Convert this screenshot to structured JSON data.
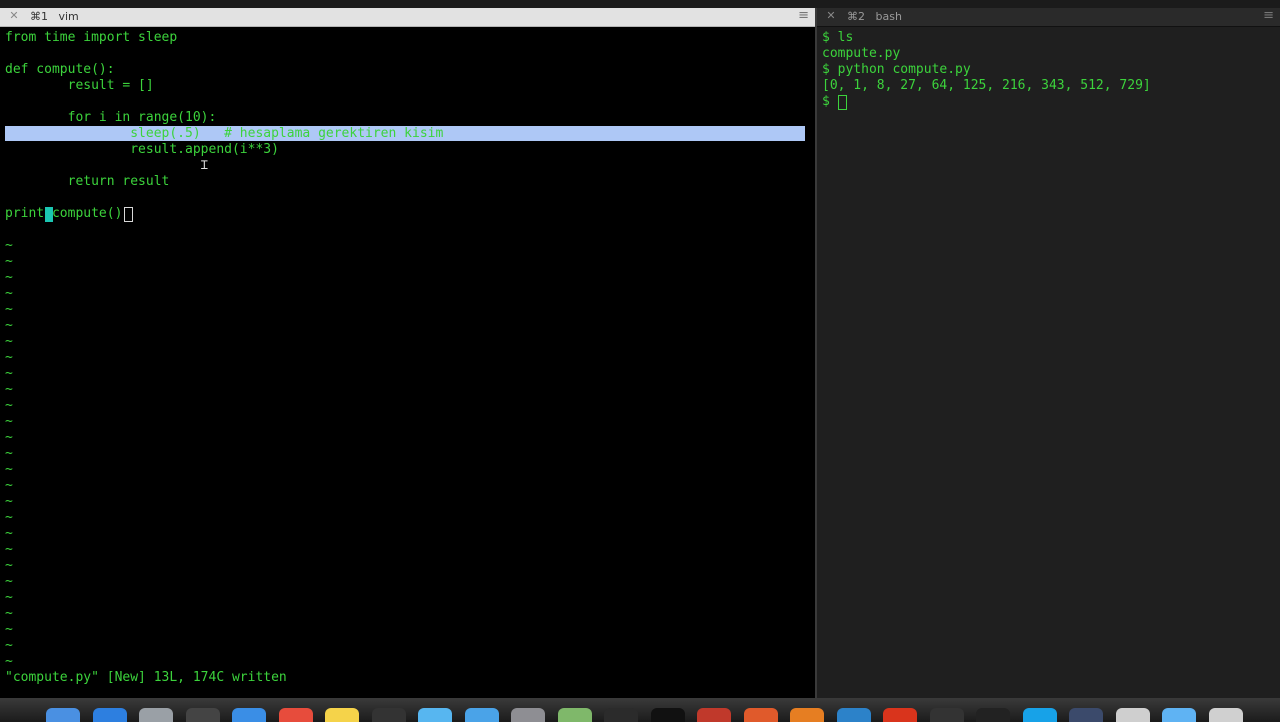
{
  "left_pane": {
    "tab": {
      "close": "✕",
      "title": "⌘1   vim",
      "menu": "≡"
    },
    "code_lines": [
      "from time import sleep",
      "",
      "def compute():",
      "        result = []",
      "",
      "        for i in range(10):",
      "                sleep(.5)   # hesaplama gerektiren kisim",
      "                result.append(i**3)",
      "",
      "        return result",
      "",
      "print compute() "
    ],
    "highlighted_line": "                sleep(.5)   # hesaplama gerektiren kisim",
    "tilde": "~",
    "status": "\"compute.py\" [New] 13L, 174C written"
  },
  "right_pane": {
    "tab": {
      "close": "✕",
      "title": "⌘2   bash",
      "menu": "≡"
    },
    "lines": [
      "$ ls",
      "compute.py",
      "$ python compute.py",
      "[0, 1, 8, 27, 64, 125, 216, 343, 512, 729]",
      "$ "
    ]
  },
  "dock": {
    "icons": [
      "finder-icon",
      "safari-icon",
      "launchpad-icon",
      "photos-icon",
      "safari-compass-icon",
      "calendar-icon",
      "notes-icon",
      "film-icon",
      "messages-icon",
      "contacts-icon",
      "settings-icon",
      "preview-icon",
      "activity-icon",
      "terminal-icon",
      "console-icon",
      "app-icon-1",
      "firefox-icon",
      "app-icon-2",
      "app-icon-3",
      "app-icon-4",
      "app-icon-5",
      "app-icon-6",
      "app-icon-7",
      "app-icon-8",
      "folder-icon",
      "trash-icon"
    ]
  },
  "colors": {
    "terminal_text": "#3cd33c",
    "tilde": "#2f6bf2",
    "selection": "#aec8f6",
    "cursor": "#1bc6b2"
  }
}
